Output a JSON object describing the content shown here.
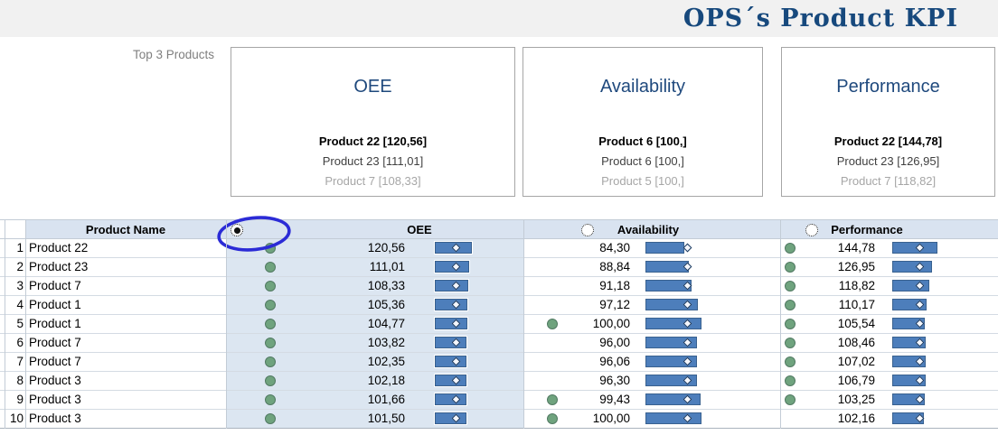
{
  "header": {
    "title": "OPS´s Product KPI"
  },
  "top3": {
    "label": "Top 3 Products",
    "cards": [
      {
        "title": "OEE",
        "lines": [
          "Product 22 [120,56]",
          "Product 23 [111,01]",
          "Product 7 [108,33]"
        ]
      },
      {
        "title": "Availability",
        "lines": [
          "Product 6 [100,]",
          "Product 6 [100,]",
          "Product 5 [100,]"
        ]
      },
      {
        "title": "Performance",
        "lines": [
          "Product 22 [144,78]",
          "Product 23 [126,95]",
          "Product 7 [118,82]"
        ]
      }
    ]
  },
  "table": {
    "columns": {
      "name": "Product Name",
      "oee": "OEE",
      "availability": "Availability",
      "performance": "Performance"
    },
    "header_icons": {
      "oee": "target-selected-icon",
      "availability": "circle-outline-icon",
      "performance": "circle-outline-icon"
    },
    "annotation": "hand-drawn-blue-circle around OEE sort icon",
    "rows": [
      {
        "num": "1",
        "name": "Product 22",
        "oee": {
          "dot": true,
          "value": "120,56"
        },
        "availability": {
          "dot": false,
          "value": "84,30"
        },
        "performance": {
          "dot": true,
          "value": "144,78"
        }
      },
      {
        "num": "2",
        "name": "Product 23",
        "oee": {
          "dot": true,
          "value": "111,01"
        },
        "availability": {
          "dot": false,
          "value": "88,84"
        },
        "performance": {
          "dot": true,
          "value": "126,95"
        }
      },
      {
        "num": "3",
        "name": "Product 7",
        "oee": {
          "dot": true,
          "value": "108,33"
        },
        "availability": {
          "dot": false,
          "value": "91,18"
        },
        "performance": {
          "dot": true,
          "value": "118,82"
        }
      },
      {
        "num": "4",
        "name": "Product 1",
        "oee": {
          "dot": true,
          "value": "105,36"
        },
        "availability": {
          "dot": false,
          "value": "97,12"
        },
        "performance": {
          "dot": true,
          "value": "110,17"
        }
      },
      {
        "num": "5",
        "name": "Product 1",
        "oee": {
          "dot": true,
          "value": "104,77"
        },
        "availability": {
          "dot": true,
          "value": "100,00"
        },
        "performance": {
          "dot": true,
          "value": "105,54"
        }
      },
      {
        "num": "6",
        "name": "Product 7",
        "oee": {
          "dot": true,
          "value": "103,82"
        },
        "availability": {
          "dot": false,
          "value": "96,00"
        },
        "performance": {
          "dot": true,
          "value": "108,46"
        }
      },
      {
        "num": "7",
        "name": "Product 7",
        "oee": {
          "dot": true,
          "value": "102,35"
        },
        "availability": {
          "dot": false,
          "value": "96,06"
        },
        "performance": {
          "dot": true,
          "value": "107,02"
        }
      },
      {
        "num": "8",
        "name": "Product 3",
        "oee": {
          "dot": true,
          "value": "102,18"
        },
        "availability": {
          "dot": false,
          "value": "96,30"
        },
        "performance": {
          "dot": true,
          "value": "106,79"
        }
      },
      {
        "num": "9",
        "name": "Product 3",
        "oee": {
          "dot": true,
          "value": "101,66"
        },
        "availability": {
          "dot": true,
          "value": "99,43"
        },
        "performance": {
          "dot": true,
          "value": "103,25"
        }
      },
      {
        "num": "10",
        "name": "Product 3",
        "oee": {
          "dot": true,
          "value": "101,50"
        },
        "availability": {
          "dot": true,
          "value": "100,00"
        },
        "performance": {
          "dot": false,
          "value": "102,16"
        }
      }
    ]
  },
  "colors": {
    "title_navy": "#17497d",
    "card_title_navy": "#1f497d",
    "section_blue": "#dce6f1",
    "bar_blue": "#4d7ebb",
    "dot_green": "#6fa37e",
    "annotation_blue": "#2b2bd6",
    "topbar_gray": "#f1f1f1"
  }
}
